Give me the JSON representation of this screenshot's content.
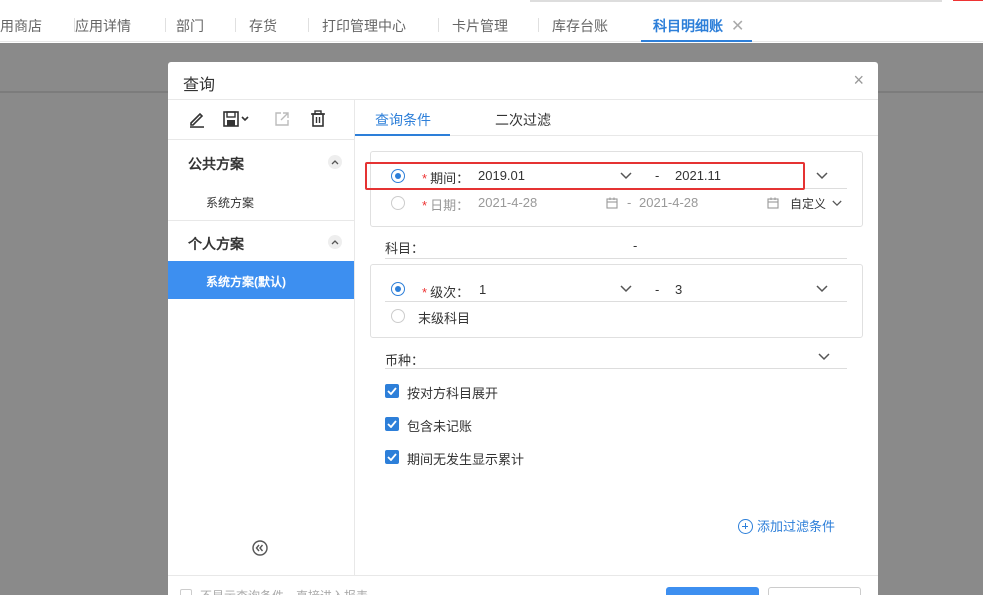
{
  "tabs": [
    {
      "label": "用商店"
    },
    {
      "label": "应用详情"
    },
    {
      "label": "部门"
    },
    {
      "label": "存货"
    },
    {
      "label": "打印管理中心"
    },
    {
      "label": "卡片管理"
    },
    {
      "label": "库存台账"
    },
    {
      "label": "科目明细账",
      "active": true
    }
  ],
  "dialog": {
    "title": "查询",
    "close": "×"
  },
  "left_panel": {
    "public_section": "公共方案",
    "public_items": [
      "系统方案"
    ],
    "personal_section": "个人方案",
    "personal_items": [
      "系统方案(默认)"
    ]
  },
  "right_panel": {
    "tabs": [
      "查询条件",
      "二次过滤"
    ],
    "period": {
      "label": "期间：",
      "required": "*",
      "from": "2019.01",
      "dash": "-",
      "to": "2021.11"
    },
    "date": {
      "label": "日期：",
      "required": "*",
      "from": "2021-4-28",
      "dash": "-",
      "to": "2021-4-28",
      "mode": "自定义"
    },
    "subject": {
      "label": "科目：",
      "dash": "-"
    },
    "level": {
      "label": "级次：",
      "required": "*",
      "from": "1",
      "dash": "-",
      "to": "3"
    },
    "leaf_subject": "末级科目",
    "currency": {
      "label": "币种："
    },
    "checkboxes": [
      {
        "label": "按对方科目展开",
        "checked": true
      },
      {
        "label": "包含未记账",
        "checked": true
      },
      {
        "label": "期间无发生显示累计",
        "checked": true
      }
    ],
    "add_filter": "添加过滤条件"
  },
  "footer": {
    "hint": "不显示查询条件，直接进入报表"
  },
  "colors": {
    "accent": "#2d7fd9",
    "selected_bg": "#3d8ff0",
    "highlight": "#e53333"
  }
}
